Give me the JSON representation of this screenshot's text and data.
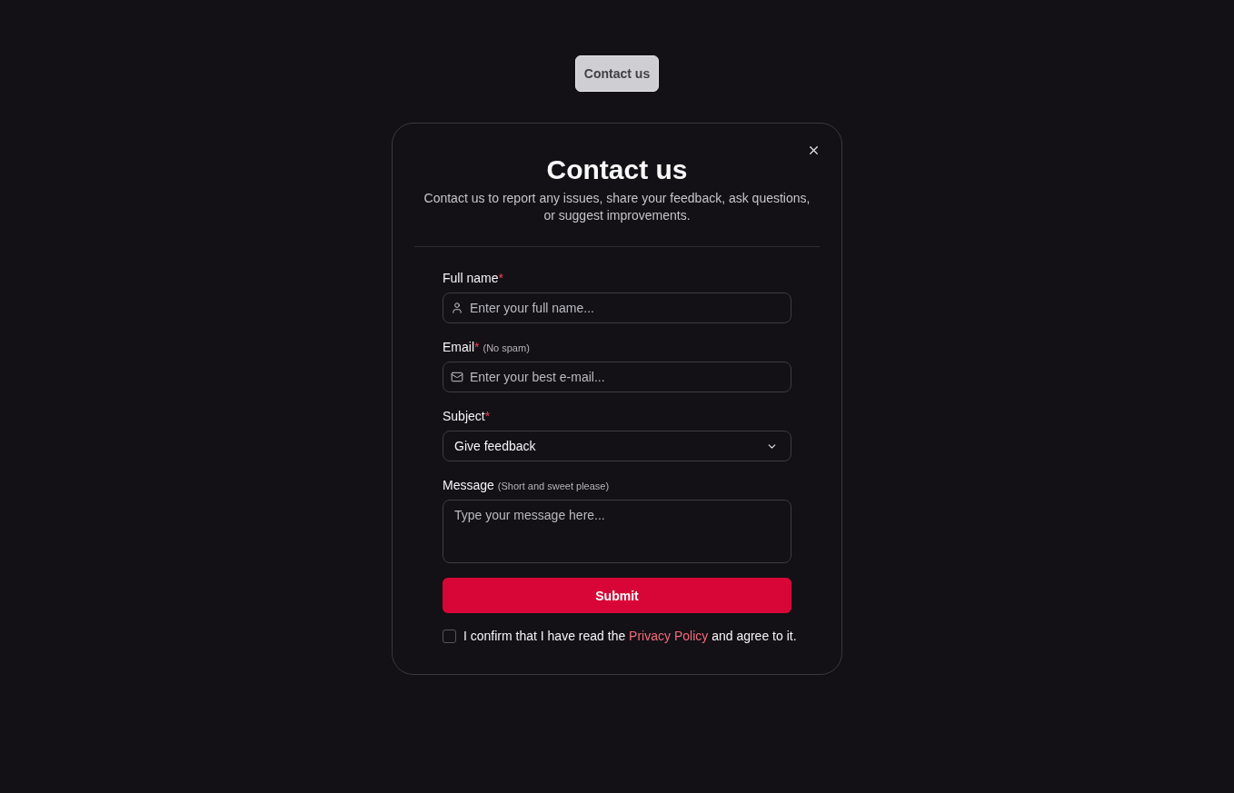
{
  "trigger_button": {
    "label": "Contact us"
  },
  "dialog": {
    "title": "Contact us",
    "description": "Contact us to report any issues, share your feedback, ask questions, or suggest improvements."
  },
  "fields": [
    {
      "kind": "text",
      "label": "Full name",
      "required_mark": "*",
      "placeholder": "Enter your full name..."
    },
    {
      "kind": "email",
      "label": "Email",
      "required_mark": "*",
      "hint": "(No spam)",
      "placeholder": "Enter your best e-mail..."
    },
    {
      "kind": "select",
      "label": "Subject",
      "required_mark": "*",
      "value": "Give feedback"
    },
    {
      "kind": "textarea",
      "label": "Message",
      "hint": "(Short and sweet please)",
      "placeholder": "Type your message here..."
    }
  ],
  "submit_button": {
    "label": "Submit"
  },
  "consent": {
    "checked": false,
    "before": "I confirm that I have read the",
    "link": "Privacy Policy",
    "after": "and agree to it."
  }
}
